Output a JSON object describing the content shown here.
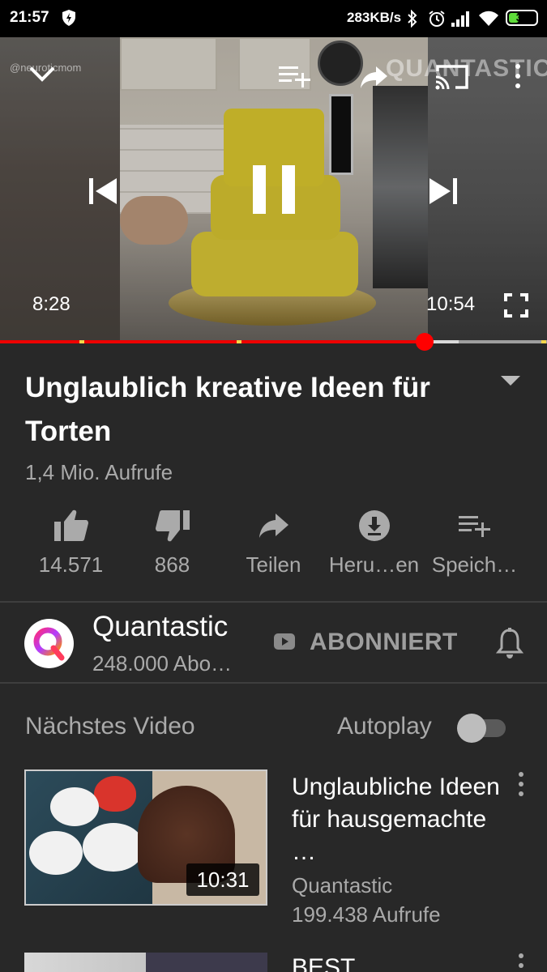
{
  "status_bar": {
    "time": "21:57",
    "speed": "283KB/s",
    "battery": "39",
    "battery_level": 0.39
  },
  "player": {
    "watermark": "@neuroticmom",
    "brand_watermark": "QUANTASTIC",
    "current_time": "8:28",
    "total_time": "10:54",
    "progress": 0.777,
    "buffered": 0.839,
    "chapter_marks": [
      0.145,
      0.432,
      0.99
    ],
    "icons": [
      "collapse-icon",
      "add-to-queue-icon",
      "share-icon",
      "cast-icon",
      "more-vert-icon",
      "previous-icon",
      "pause-icon",
      "next-icon",
      "fullscreen-icon"
    ]
  },
  "video": {
    "title": "Unglaublich kreative Ideen für Torten",
    "views": "1,4 Mio. Aufrufe"
  },
  "actions": [
    {
      "label": "14.571",
      "icon": "like-icon"
    },
    {
      "label": "868",
      "icon": "dislike-icon"
    },
    {
      "label": "Teilen",
      "icon": "share-icon"
    },
    {
      "label": "Heru…en",
      "icon": "download-icon"
    },
    {
      "label": "Speich…",
      "icon": "save-playlist-icon"
    }
  ],
  "channel": {
    "name": "Quantastic",
    "subscribers": "248.000 Abo…",
    "subscribe_label": "ABONNIERT"
  },
  "up_next": {
    "label": "Nächstes Video",
    "autoplay_label": "Autoplay",
    "autoplay_on": false,
    "items": [
      {
        "title": "Unglaubliche Ideen für hausgemachte …",
        "channel": "Quantastic",
        "views": "199.438 Aufrufe",
        "duration": "10:31"
      },
      {
        "title": "BEST"
      }
    ]
  },
  "colors": {
    "accent": "#ff0000",
    "background": "#282828",
    "secondary_text": "#aaaaaa"
  }
}
